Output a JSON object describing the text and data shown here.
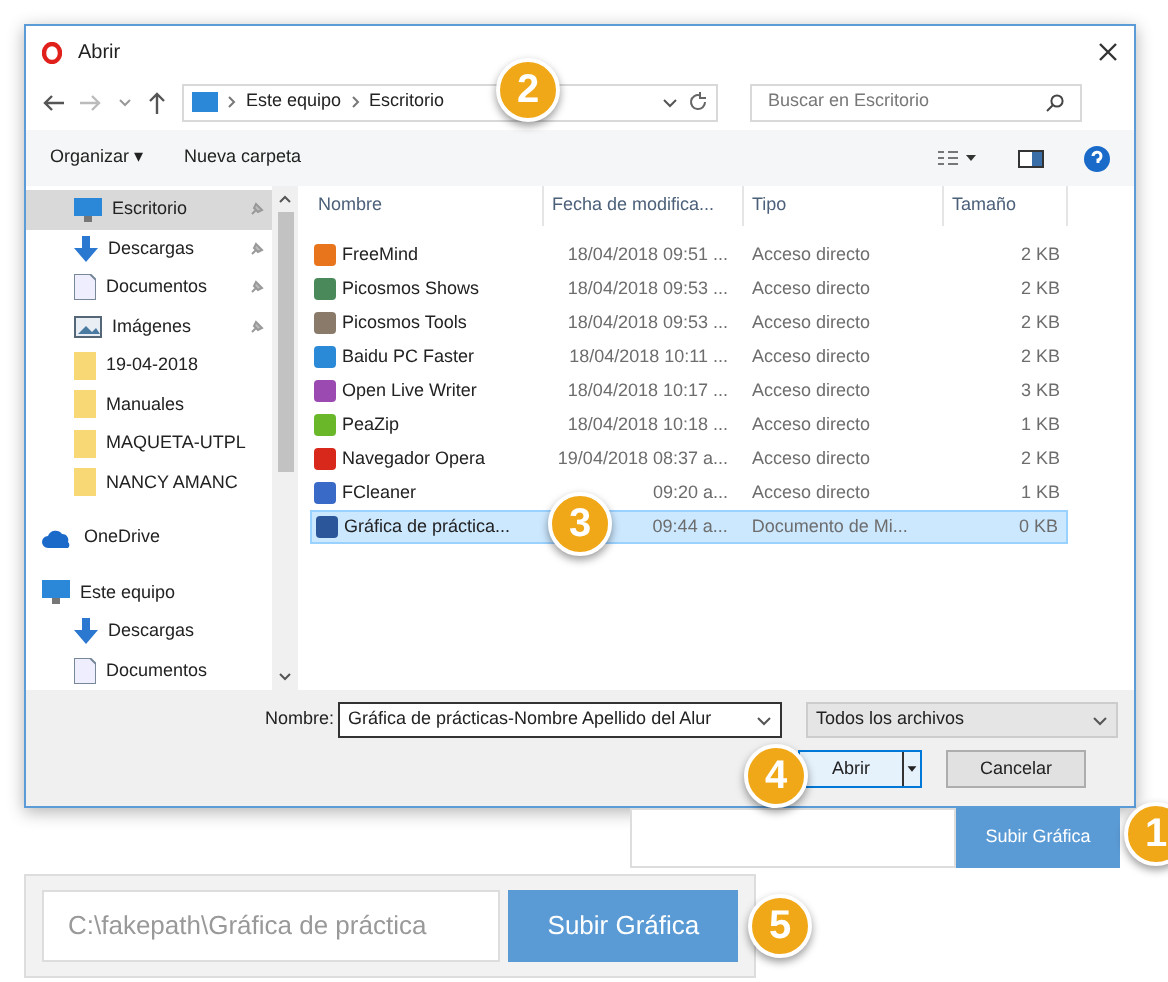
{
  "window": {
    "title": "Abrir"
  },
  "address": {
    "crumbs": [
      "Este equipo",
      "Escritorio"
    ]
  },
  "search": {
    "placeholder": "Buscar en Escritorio"
  },
  "toolbar": {
    "organize": "Organizar ▾",
    "new_folder": "Nueva carpeta"
  },
  "sidebar": {
    "items": [
      {
        "label": "Escritorio",
        "kind": "desktop",
        "pinned": true,
        "selected": true
      },
      {
        "label": "Descargas",
        "kind": "download",
        "pinned": true,
        "selected": false
      },
      {
        "label": "Documentos",
        "kind": "document",
        "pinned": true,
        "selected": false
      },
      {
        "label": "Imágenes",
        "kind": "images",
        "pinned": true,
        "selected": false
      },
      {
        "label": "19-04-2018",
        "kind": "folder",
        "pinned": false,
        "selected": false
      },
      {
        "label": "Manuales",
        "kind": "folder",
        "pinned": false,
        "selected": false
      },
      {
        "label": "MAQUETA-UTPL",
        "kind": "folder",
        "pinned": false,
        "selected": false
      },
      {
        "label": "NANCY AMANC",
        "kind": "folder",
        "pinned": false,
        "selected": false
      },
      {
        "label": "OneDrive",
        "kind": "cloud",
        "pinned": false,
        "selected": false
      },
      {
        "label": "Este equipo",
        "kind": "computer",
        "pinned": false,
        "selected": false
      },
      {
        "label": "Descargas",
        "kind": "download",
        "pinned": false,
        "selected": false
      },
      {
        "label": "Documentos",
        "kind": "document",
        "pinned": false,
        "selected": false
      }
    ]
  },
  "table": {
    "columns": [
      "Nombre",
      "Fecha de modifica...",
      "Tipo",
      "Tamaño"
    ],
    "rows": [
      {
        "name": "FreeMind",
        "date": "18/04/2018 09:51 ...",
        "type": "Acceso directo",
        "size": "2 KB",
        "color": "#e8741c",
        "selected": false
      },
      {
        "name": "Picosmos Shows",
        "date": "18/04/2018 09:53 ...",
        "type": "Acceso directo",
        "size": "2 KB",
        "color": "#4a8a5a",
        "selected": false
      },
      {
        "name": "Picosmos Tools",
        "date": "18/04/2018 09:53 ...",
        "type": "Acceso directo",
        "size": "2 KB",
        "color": "#8a7a6a",
        "selected": false
      },
      {
        "name": "Baidu PC Faster",
        "date": "18/04/2018 10:11 ...",
        "type": "Acceso directo",
        "size": "2 KB",
        "color": "#2a8ad8",
        "selected": false
      },
      {
        "name": "Open Live Writer",
        "date": "18/04/2018 10:17 ...",
        "type": "Acceso directo",
        "size": "3 KB",
        "color": "#9a4ab0",
        "selected": false
      },
      {
        "name": "PeaZip",
        "date": "18/04/2018 10:18 ...",
        "type": "Acceso directo",
        "size": "1 KB",
        "color": "#6ab82a",
        "selected": false
      },
      {
        "name": "Navegador Opera",
        "date": "19/04/2018 08:37 a...",
        "type": "Acceso directo",
        "size": "2 KB",
        "color": "#d8281c",
        "selected": false
      },
      {
        "name": "FCleaner",
        "date": "09:20 a...",
        "type": "Acceso directo",
        "size": "1 KB",
        "color": "#3a6ac8",
        "selected": false
      },
      {
        "name": "Gráfica de práctica...",
        "date": "09:44 a...",
        "type": "Documento de Mi...",
        "size": "0 KB",
        "color": "#2b579a",
        "selected": true
      }
    ]
  },
  "footer": {
    "name_label": "Nombre:",
    "name_value": "Gráfica de prácticas-Nombre Apellido del Alur",
    "filter": "Todos los archivos",
    "open": "Abrir",
    "cancel": "Cancelar"
  },
  "upload_form": {
    "button": "Subir Gráfica"
  },
  "result_form": {
    "path": "C:\\fakepath\\Gráfica de práctica",
    "button": "Subir Gráfica"
  },
  "badges": [
    "2",
    "3",
    "4",
    "1",
    "5"
  ]
}
